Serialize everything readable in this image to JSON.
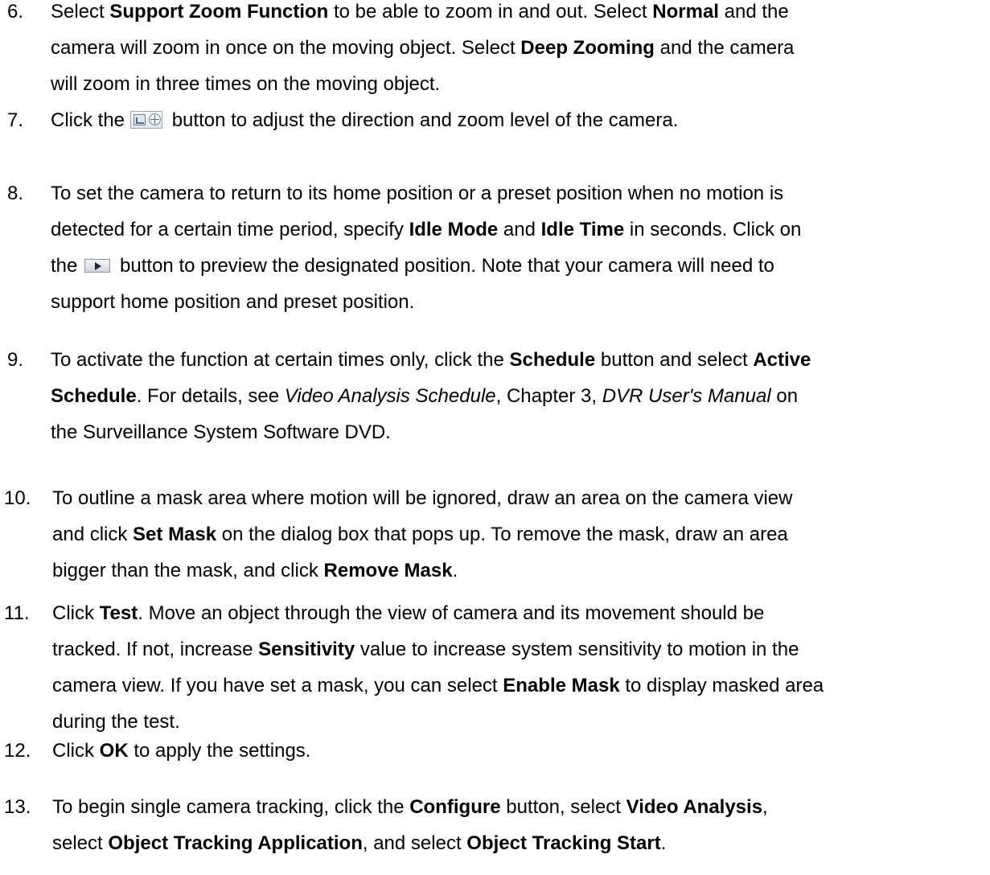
{
  "steps": [
    {
      "number": "6.",
      "lines": [
        [
          {
            "t": "Select "
          },
          {
            "t": "Support Zoom Function",
            "b": true
          },
          {
            "t": " to be able to zoom in and out. Select "
          },
          {
            "t": "Normal",
            "b": true
          },
          {
            "t": " and the"
          }
        ],
        [
          {
            "t": "camera will zoom in once on the moving object. Select "
          },
          {
            "t": "Deep Zooming",
            "b": true
          },
          {
            "t": " and the camera"
          }
        ],
        [
          {
            "t": "will zoom in three times on the moving object."
          }
        ]
      ]
    },
    {
      "number": "7.",
      "lines": [
        [
          {
            "t": "Click the"
          },
          {
            "icon": "ptz-control-icon"
          },
          {
            "t": " button to adjust the direction and zoom level of the camera."
          }
        ]
      ]
    },
    {
      "number": "8.",
      "lines": [
        [
          {
            "t": "To set the camera to return to its home position or a preset position when no motion is"
          }
        ],
        [
          {
            "t": "detected for a certain time period, specify "
          },
          {
            "t": "Idle Mode",
            "b": true
          },
          {
            "t": " and "
          },
          {
            "t": "Idle Time",
            "b": true
          },
          {
            "t": " in seconds. Click on"
          }
        ],
        [
          {
            "t": "the"
          },
          {
            "icon": "play-preview-icon"
          },
          {
            "t": " button to preview the designated position. Note that your camera will need to"
          }
        ],
        [
          {
            "t": "support home position and preset position."
          }
        ]
      ]
    },
    {
      "number": "9.",
      "lines": [
        [
          {
            "t": "To activate the function at certain times only, click the "
          },
          {
            "t": "Schedule",
            "b": true
          },
          {
            "t": " button and select "
          },
          {
            "t": "Active",
            "b": true
          }
        ],
        [
          {
            "t": "Schedule",
            "b": true
          },
          {
            "t": ". For details, see "
          },
          {
            "t": "Video Analysis Schedule",
            "i": true
          },
          {
            "t": ", Chapter 3, "
          },
          {
            "t": "DVR User's Manual",
            "i": true
          },
          {
            "t": " on"
          }
        ],
        [
          {
            "t": "the Surveillance System Software DVD."
          }
        ]
      ]
    },
    {
      "number": "10.",
      "lines": [
        [
          {
            "t": "To outline a mask area where motion will be ignored, draw an area on the camera view"
          }
        ],
        [
          {
            "t": "and click "
          },
          {
            "t": "Set Mask",
            "b": true
          },
          {
            "t": " on the dialog box that pops up. To remove the mask, draw an area"
          }
        ],
        [
          {
            "t": "bigger than the mask, and click "
          },
          {
            "t": "Remove Mask",
            "b": true
          },
          {
            "t": "."
          }
        ]
      ]
    },
    {
      "number": "11.",
      "lines": [
        [
          {
            "t": "Click "
          },
          {
            "t": "Test",
            "b": true
          },
          {
            "t": ". Move an object through the view of camera and its movement should be"
          }
        ],
        [
          {
            "t": "tracked. If not, increase "
          },
          {
            "t": "Sensitivity",
            "b": true
          },
          {
            "t": " value to increase system sensitivity to motion in the"
          }
        ],
        [
          {
            "t": "camera view. If you have set a mask, you can select "
          },
          {
            "t": "Enable Mask",
            "b": true
          },
          {
            "t": " to display masked area"
          }
        ],
        [
          {
            "t": "during the test."
          }
        ]
      ]
    },
    {
      "number": "12.",
      "lines": [
        [
          {
            "t": "Click "
          },
          {
            "t": "OK",
            "b": true
          },
          {
            "t": " to apply the settings."
          }
        ]
      ]
    },
    {
      "number": "13.",
      "lines": [
        [
          {
            "t": "To begin single camera tracking, click the "
          },
          {
            "t": "Configure",
            "b": true
          },
          {
            "t": " button, select "
          },
          {
            "t": "Video Analysis",
            "b": true
          },
          {
            "t": ","
          }
        ],
        [
          {
            "t": "select "
          },
          {
            "t": "Object Tracking Application",
            "b": true
          },
          {
            "t": ", and select "
          },
          {
            "t": "Object Tracking Start",
            "b": true
          },
          {
            "t": "."
          }
        ]
      ]
    }
  ]
}
